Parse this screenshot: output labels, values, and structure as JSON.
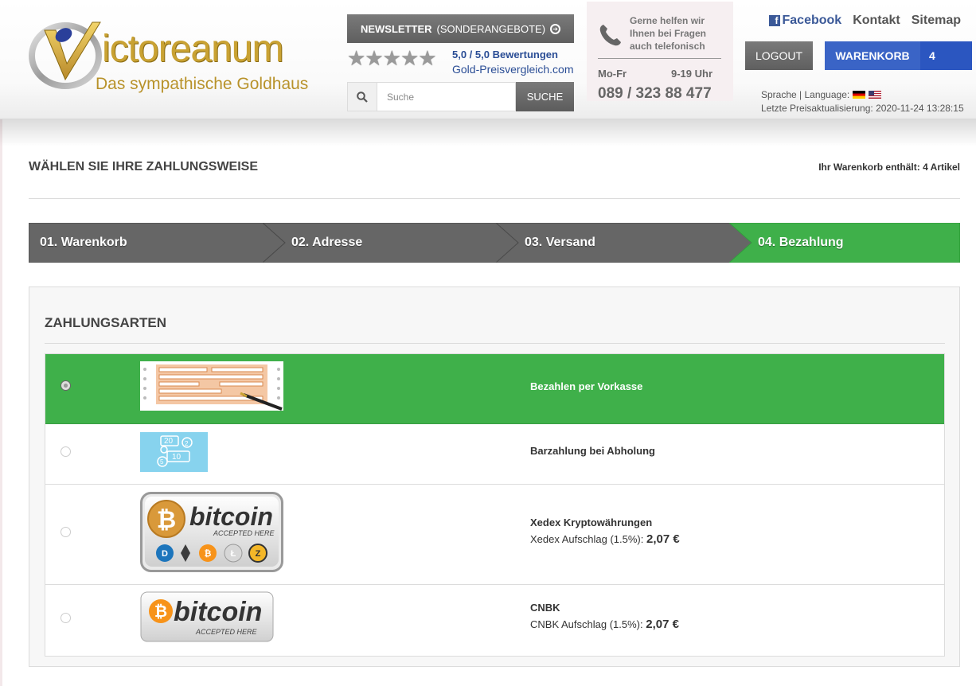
{
  "brand": {
    "logo_text": "ictoreanum",
    "tagline": "Das sympathische Goldhaus",
    "accent_gold": "#c9a233"
  },
  "header": {
    "newsletter_bold": "NEWSLETTER",
    "newsletter_rest": "(SONDERANGEBOTE)",
    "stars_count": 5,
    "rating": "5,0 / 5,0 Bewertungen",
    "vergleich": "Gold-Preisvergleich.com",
    "search_placeholder": "Suche",
    "search_button": "SUCHE",
    "help_text": "Gerne helfen wir Ihnen bei Fragen auch telefonisch",
    "days": "Mo-Fr",
    "hours": "9-19 Uhr",
    "phone": "089 / 323 88 477",
    "links": {
      "facebook": "Facebook",
      "kontakt": "Kontakt",
      "sitemap": "Sitemap"
    },
    "logout": "LOGOUT",
    "cart_label": "WARENKORB",
    "cart_count": "4",
    "language_label": "Sprache | Language:",
    "last_update": "Letzte Preisaktualisierung: 2020-11-24 13:28:15",
    "cart_blue": "#3a64c6"
  },
  "main": {
    "page_title": "WÄHLEN SIE IHRE ZAHLUNGSWEISE",
    "cart_info": "Ihr Warenkorb enthält: 4 Artikel",
    "steps": [
      {
        "label": "01. Warenkorb",
        "active": false
      },
      {
        "label": "02. Adresse",
        "active": false
      },
      {
        "label": "03. Versand",
        "active": false
      },
      {
        "label": "04. Bezahlung",
        "active": true
      }
    ],
    "step_gray": "#666666",
    "step_green": "#3fb04a",
    "panel_title": "ZAHLUNGSARTEN",
    "methods": [
      {
        "name": "Bezahlen per Vorkasse",
        "fee_label": "",
        "fee_value": "",
        "selected": true,
        "image_icon": "transfer-form-icon"
      },
      {
        "name": "Barzahlung bei Abholung",
        "fee_label": "",
        "fee_value": "",
        "selected": false,
        "image_icon": "cash-icon"
      },
      {
        "name": "Xedex Kryptowährungen",
        "fee_label": "Xedex Aufschlag (1.5%):",
        "fee_value": "2,07 €",
        "selected": false,
        "image_icon": "bitcoin-crypto-badge"
      },
      {
        "name": "CNBK",
        "fee_label": "CNBK Aufschlag (1.5%):",
        "fee_value": "2,07 €",
        "selected": false,
        "image_icon": "bitcoin-badge"
      }
    ],
    "bitcoin_badge": {
      "word": "bitcoin",
      "sub": "ACCEPTED HERE"
    }
  }
}
